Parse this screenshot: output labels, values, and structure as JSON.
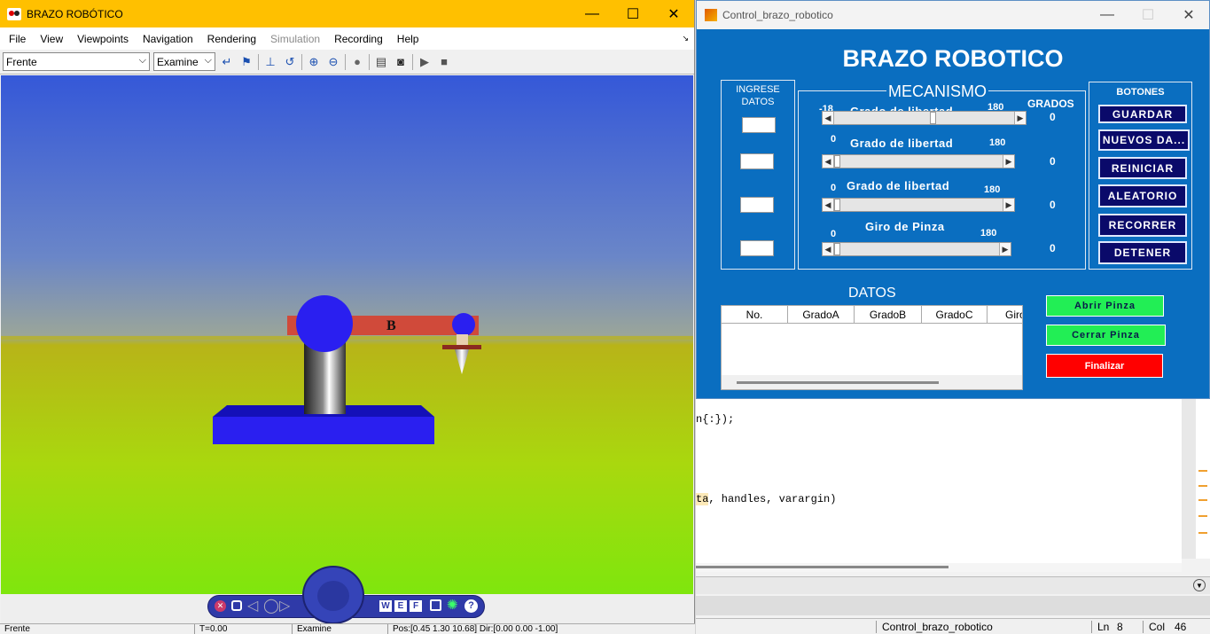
{
  "vr_window": {
    "title": "BRAZO ROBÓTICO",
    "menu": [
      {
        "label": "File",
        "enabled": true
      },
      {
        "label": "View",
        "enabled": true
      },
      {
        "label": "Viewpoints",
        "enabled": true
      },
      {
        "label": "Navigation",
        "enabled": true
      },
      {
        "label": "Rendering",
        "enabled": true
      },
      {
        "label": "Simulation",
        "enabled": false
      },
      {
        "label": "Recording",
        "enabled": true
      },
      {
        "label": "Help",
        "enabled": true
      }
    ],
    "viewpoint_select": "Frente",
    "navigation_select": "Examine",
    "scene_label": "B",
    "status": {
      "viewpoint": "Frente",
      "time": "T=0.00",
      "mode": "Examine",
      "position": "Pos:[0.45 1.30 10.68] Dir:[0.00 0.00 -1.00]"
    },
    "nav_keys": [
      "W",
      "E",
      "F"
    ],
    "colors": {
      "title_bar": "#ffc000",
      "sky": "#3558d8",
      "ground": "#7fe60d",
      "base": "#2a1ff0",
      "arm": "#d04a3a",
      "joint": "#2a1ff0"
    }
  },
  "editor": {
    "line1": "n{:});",
    "line2_highlight": "ta",
    "line2_rest": ", handles, varargin)",
    "file": "Control_brazo_robotico",
    "ln_label": "Ln",
    "ln": "8",
    "col_label": "Col",
    "col": "46"
  },
  "control_window": {
    "title": "Control_brazo_robotico",
    "heading": "BRAZO ROBOTICO",
    "ingrese": "INGRESE DATOS",
    "mecanismo": "MECANISMO",
    "grados": "GRADOS",
    "botones": "BOTONES",
    "sliders": [
      {
        "label": "Grado de libertad",
        "min": "-18",
        "max": "180",
        "value": "0",
        "level": 0.55
      },
      {
        "label": "Grado de libertad",
        "min": "0",
        "max": "180",
        "value": "0",
        "level": 0.0
      },
      {
        "label": "Grado de libertad",
        "min": "0",
        "max": "180",
        "value": "0",
        "level": 0.0
      },
      {
        "label": "Giro de Pinza",
        "min": "0",
        "max": "180",
        "value": "0",
        "level": 0.0
      }
    ],
    "buttons": [
      "GUARDAR",
      "NUEVOS DA...",
      "REINICIAR",
      "ALEATORIO",
      "RECORRER",
      "DETENER"
    ],
    "datos_label": "DATOS",
    "table_headers": [
      "No.",
      "GradoA",
      "GradoB",
      "GradoC",
      "Giro"
    ],
    "abrir": "Abrir Pinza",
    "cerrar": "Cerrar Pinza",
    "finalizar": "Finalizar",
    "colors": {
      "background": "#0a6ec0",
      "button": "#0a0a6a",
      "green": "#22ee55",
      "red": "#ff0000"
    }
  }
}
